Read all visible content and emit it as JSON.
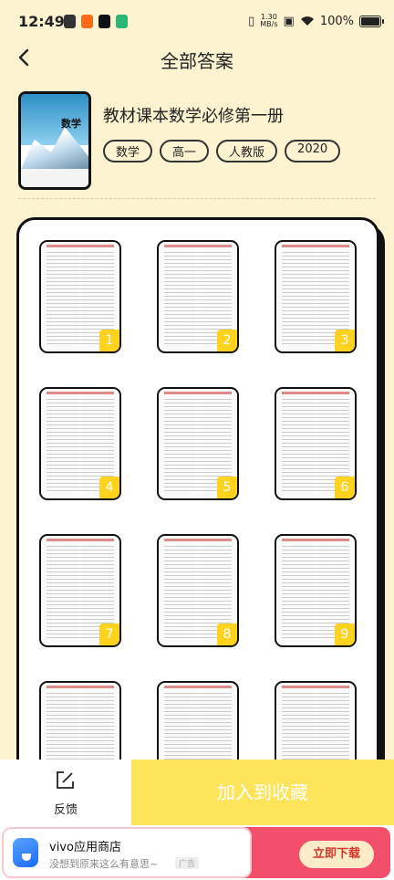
{
  "status_bar": {
    "time": "12:49",
    "net_speed_value": "1.30",
    "net_speed_unit": "MB/s",
    "battery": "100%"
  },
  "header": {
    "title": "全部答案"
  },
  "book": {
    "cover_text": "数学",
    "title": "教材课本数学必修第一册",
    "tags": [
      "数学",
      "高一",
      "人教版",
      "2020"
    ]
  },
  "pages": [
    {
      "label": "1"
    },
    {
      "label": "2"
    },
    {
      "label": "3"
    },
    {
      "label": "4"
    },
    {
      "label": "5"
    },
    {
      "label": "6"
    },
    {
      "label": "7"
    },
    {
      "label": "8"
    },
    {
      "label": "9"
    },
    {
      "label": ""
    },
    {
      "label": ""
    },
    {
      "label": ""
    }
  ],
  "actions": {
    "feedback_label": "反馈",
    "collect_label": "加入到收藏"
  },
  "ad": {
    "app_name": "vivo应用商店",
    "description": "没想到原来这么有意思~",
    "ad_tag": "广告",
    "download_label": "立即下载"
  },
  "colors": {
    "background": "#fdf3d1",
    "accent_yellow": "#fde45a",
    "badge_yellow": "#ffd21e",
    "ad_red": "#f2506a"
  }
}
